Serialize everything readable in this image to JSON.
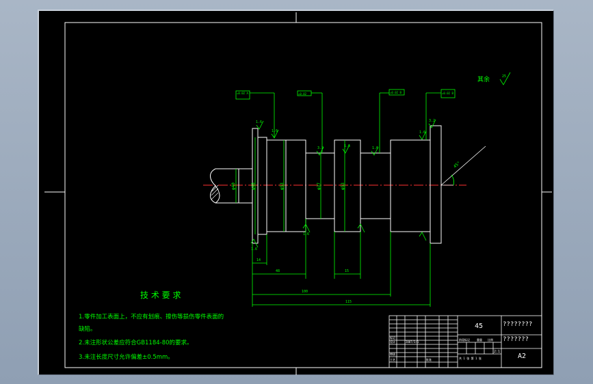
{
  "drawing": {
    "roughness_symbol_label": "其余",
    "roughness_symbol_value": "25",
    "tolerance_boxes": [
      "=0.02 A",
      "=0.02",
      "=0.02 B",
      "=0.02 B"
    ],
    "diameter_labels": [
      "φ40",
      "φ48",
      "φ53",
      "φ37",
      "φ53"
    ],
    "roughness_values": [
      "25",
      "1.6",
      "1.6",
      "3.2",
      "1.6",
      "1.6",
      "1.6",
      "3.2",
      "1.6",
      "1.6"
    ],
    "chamfer_label": "45°",
    "dimensions": {
      "d14": "14",
      "d48": "48",
      "d15": "15",
      "d100": "100",
      "d115": "115"
    }
  },
  "technical_requirements": {
    "title": "技 术 要 求",
    "lines": [
      "1.零件加工表面上，不应有划痕、擦伤等损伤零件表面的",
      "缺陷。",
      "2.未注形状公差应符合GB1184-80的要求。",
      "3.未注长度尺寸允许偏差±0.5mm。"
    ]
  },
  "title_block": {
    "material": "45",
    "name": "????????",
    "drawing_no": "???????",
    "sheet_size": "A2",
    "scale": "2:1",
    "label_design": "设计",
    "label_check": "审核",
    "label_process": "工艺",
    "label_marks": "标记",
    "label_approve": "批准",
    "label_stage": "阶段标记",
    "label_weight": "重量",
    "label_ratio": "比例",
    "label_sheet": "共 1 张  第 1 张",
    "label_date": "2007/3/1"
  },
  "colors": {
    "background": "#000000",
    "line": "#ffffff",
    "dimension": "#00ff00",
    "centerline": "#ff3030",
    "outer_bg": "#9aa9bc"
  }
}
